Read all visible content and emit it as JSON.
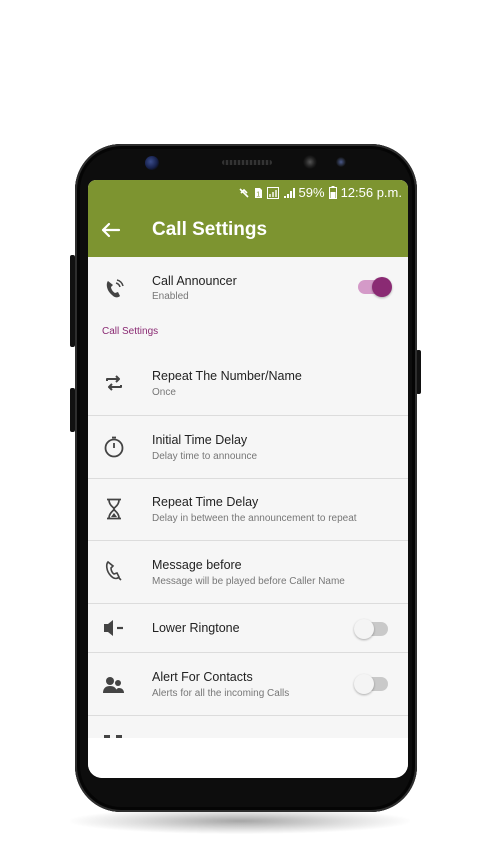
{
  "status_bar": {
    "battery": "59%",
    "time": "12:56 p.m."
  },
  "app_bar": {
    "title": "Call Settings",
    "back_icon": "arrow-back-icon"
  },
  "rows": {
    "call_announcer": {
      "title": "Call Announcer",
      "subtitle": "Enabled",
      "toggle": "on"
    },
    "section_header": "Call Settings",
    "repeat_number": {
      "title": "Repeat The Number/Name",
      "subtitle": "Once"
    },
    "initial_delay": {
      "title": "Initial Time Delay",
      "subtitle": "Delay time to announce"
    },
    "repeat_delay": {
      "title": "Repeat Time Delay",
      "subtitle": "Delay in between the announcement to repeat"
    },
    "message_before": {
      "title": "Message before",
      "subtitle": "Message will be played before Caller Name"
    },
    "lower_ringtone": {
      "title": "Lower Ringtone",
      "toggle": "off"
    },
    "alert_contacts": {
      "title": "Alert For Contacts",
      "subtitle": "Alerts for all the incoming Calls",
      "toggle": "off"
    }
  },
  "colors": {
    "app_bar": "#7d9430",
    "accent": "#8a2a73",
    "toggle_on_track": "#d49ac8"
  }
}
